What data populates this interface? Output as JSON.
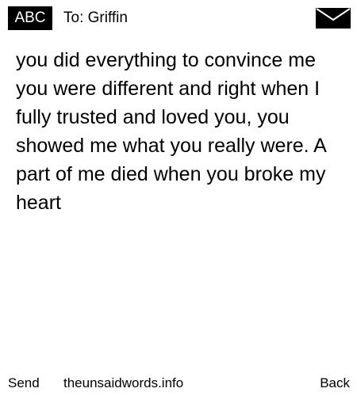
{
  "header": {
    "input_mode": "ABC",
    "recipient_label": "To: Griffin",
    "status_icon": "envelope-icon"
  },
  "message": {
    "body": "you did everything to convince me you were different and right when I fully trusted and loved you, you showed me what you really were. A part of me died when you broke my heart"
  },
  "softkeys": {
    "left": "Send",
    "center": "theunsaidwords.info",
    "right": "Back"
  },
  "colors": {
    "background": "#ffffff",
    "text": "#000000",
    "badge_background": "#000000",
    "badge_text": "#ffffff"
  }
}
